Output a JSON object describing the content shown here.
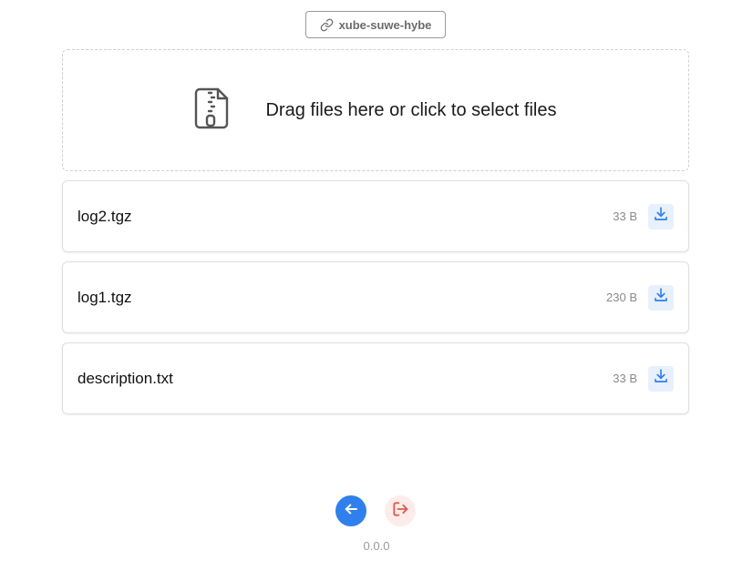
{
  "share": {
    "code": "xube-suwe-hybe",
    "icon": "link-icon"
  },
  "dropzone": {
    "text": "Drag files here or click to select files",
    "icon": "zip-file-icon"
  },
  "files": [
    {
      "name": "log2.tgz",
      "size": "33 B",
      "icon": "download-icon"
    },
    {
      "name": "log1.tgz",
      "size": "230 B",
      "icon": "download-icon"
    },
    {
      "name": "description.txt",
      "size": "33 B",
      "icon": "download-icon"
    }
  ],
  "footer": {
    "back_icon": "arrow-left-icon",
    "logout_icon": "logout-icon",
    "version": "0.0.0"
  },
  "colors": {
    "accent": "#2f80ed",
    "download_bg": "#e7f0fc",
    "logout": "#e05a4e",
    "logout_bg": "#fdecea"
  }
}
